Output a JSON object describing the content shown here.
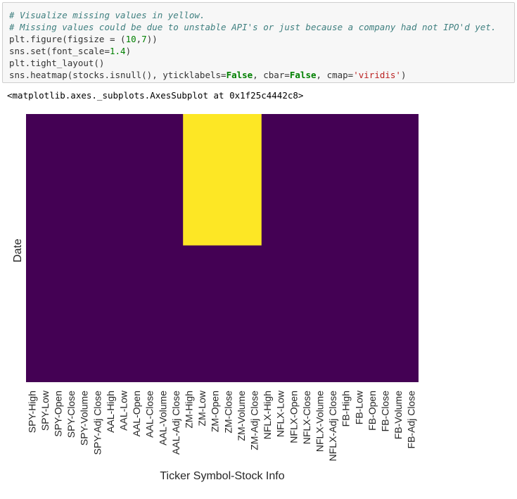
{
  "code_cell": {
    "lines": [
      [
        {
          "t": "# Visualize missing values in yellow.",
          "c": "comment"
        }
      ],
      [
        {
          "t": "# Missing values could be due to unstable API's or just because a company had not IPO'd yet.",
          "c": "comment"
        }
      ],
      [
        {
          "t": "plt.figure(figsize = (",
          "c": ""
        },
        {
          "t": "10",
          "c": "number"
        },
        {
          "t": ",",
          "c": ""
        },
        {
          "t": "7",
          "c": "number"
        },
        {
          "t": "))",
          "c": ""
        }
      ],
      [
        {
          "t": "sns.set(font_scale=",
          "c": ""
        },
        {
          "t": "1.4",
          "c": "number"
        },
        {
          "t": ")",
          "c": ""
        }
      ],
      [
        {
          "t": "plt.tight_layout()",
          "c": ""
        }
      ],
      [
        {
          "t": "sns.heatmap(stocks.isnull(), yticklabels=",
          "c": ""
        },
        {
          "t": "False",
          "c": "kw"
        },
        {
          "t": ", cbar=",
          "c": ""
        },
        {
          "t": "False",
          "c": "kw"
        },
        {
          "t": ", cmap=",
          "c": ""
        },
        {
          "t": "'viridis'",
          "c": "str"
        },
        {
          "t": ")",
          "c": ""
        }
      ]
    ]
  },
  "output": {
    "repr": "<matplotlib.axes._subplots.AxesSubplot at 0x1f25c4442c8>"
  },
  "chart_data": {
    "type": "heatmap",
    "title": "",
    "xlabel": "Ticker Symbol-Stock Info",
    "ylabel": "Date",
    "yticklabels": false,
    "colorbar": false,
    "cmap": "viridis",
    "colors": {
      "false": "#440154",
      "true": "#fde725"
    },
    "columns": [
      "SPY-High",
      "SPY-Low",
      "SPY-Open",
      "SPY-Close",
      "SPY-Volume",
      "SPY-Adj Close",
      "AAL-High",
      "AAL-Low",
      "AAL-Open",
      "AAL-Close",
      "AAL-Volume",
      "AAL-Adj Close",
      "ZM-High",
      "ZM-Low",
      "ZM-Open",
      "ZM-Close",
      "ZM-Volume",
      "ZM-Adj Close",
      "NFLX-High",
      "NFLX-Low",
      "NFLX-Open",
      "NFLX-Close",
      "NFLX-Volume",
      "NFLX-Adj Close",
      "FB-High",
      "FB-Low",
      "FB-Open",
      "FB-Close",
      "FB-Volume",
      "FB-Adj Close"
    ],
    "missing_blocks": [
      {
        "columns": [
          "ZM-High",
          "ZM-Low",
          "ZM-Open",
          "ZM-Close",
          "ZM-Volume",
          "ZM-Adj Close"
        ],
        "row_fraction_start": 0.0,
        "row_fraction_end": 0.49
      }
    ]
  }
}
